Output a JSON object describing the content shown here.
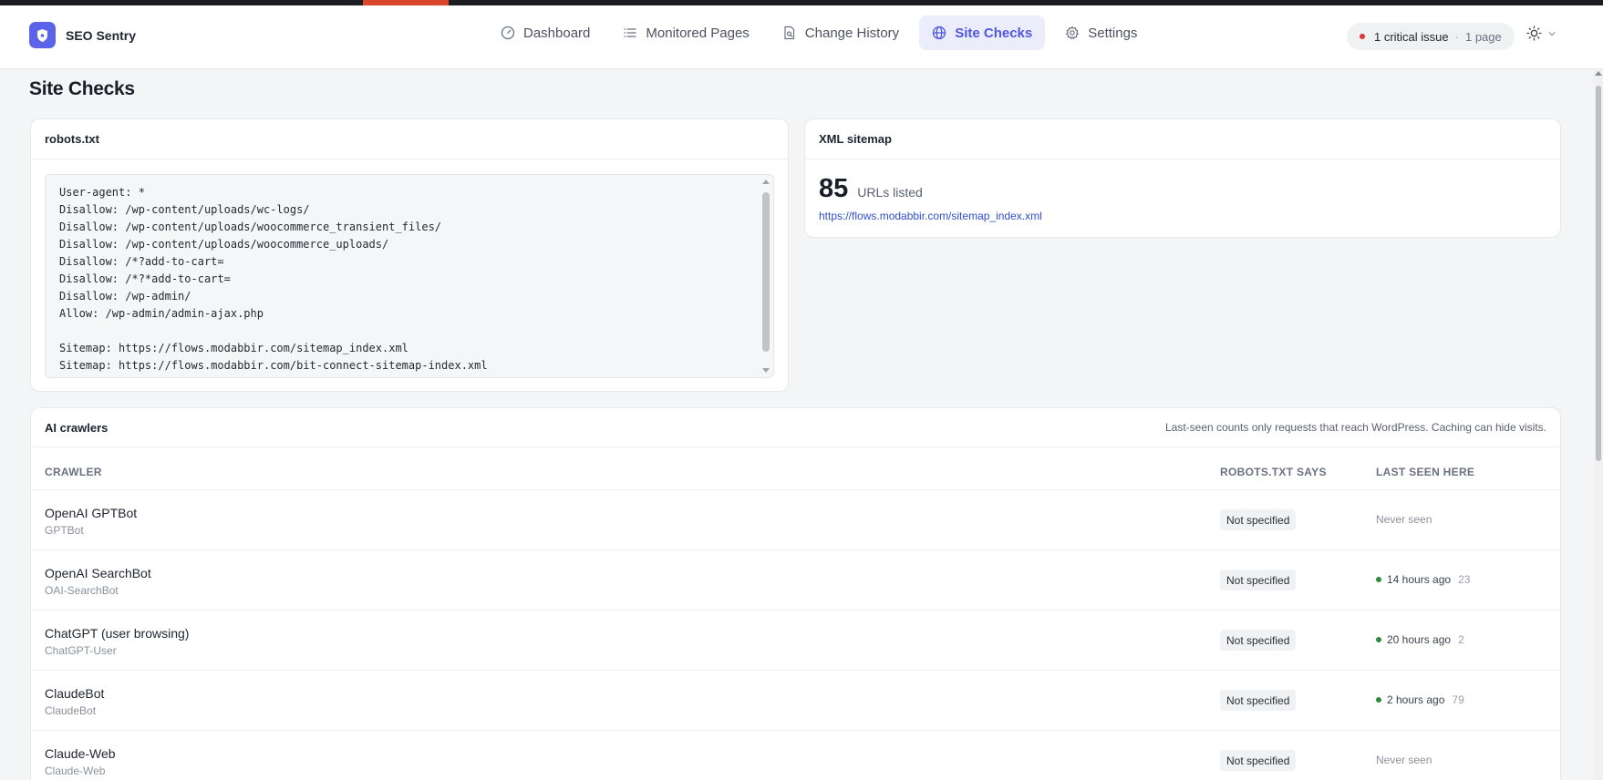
{
  "brand": {
    "name": "SEO Sentry"
  },
  "nav": [
    {
      "label": "Dashboard",
      "icon": "dashboard-gauge-icon",
      "active": false
    },
    {
      "label": "Monitored Pages",
      "icon": "list-icon",
      "active": false
    },
    {
      "label": "Change History",
      "icon": "document-search-icon",
      "active": false
    },
    {
      "label": "Site Checks",
      "icon": "globe-icon",
      "active": true
    },
    {
      "label": "Settings",
      "icon": "gear-icon",
      "active": false
    }
  ],
  "status": {
    "main": "1 critical issue",
    "separator": "·",
    "sub": "1 page"
  },
  "page": {
    "title": "Site Checks"
  },
  "robots": {
    "title": "robots.txt",
    "content": "User-agent: *\nDisallow: /wp-content/uploads/wc-logs/\nDisallow: /wp-content/uploads/woocommerce_transient_files/\nDisallow: /wp-content/uploads/woocommerce_uploads/\nDisallow: /*?add-to-cart=\nDisallow: /*?*add-to-cart=\nDisallow: /wp-admin/\nAllow: /wp-admin/admin-ajax.php\n\nSitemap: https://flows.modabbir.com/sitemap_index.xml\nSitemap: https://flows.modabbir.com/bit-connect-sitemap-index.xml"
  },
  "sitemap": {
    "title": "XML sitemap",
    "count": "85",
    "count_label": "URLs listed",
    "url": "https://flows.modabbir.com/sitemap_index.xml"
  },
  "crawlers": {
    "title": "AI crawlers",
    "note": "Last-seen counts only requests that reach WordPress. Caching can hide visits.",
    "columns": {
      "crawler": "CRAWLER",
      "robots": "ROBOTS.TXT SAYS",
      "last_seen": "LAST SEEN HERE"
    },
    "rows": [
      {
        "name": "OpenAI GPTBot",
        "agent": "GPTBot",
        "robots": "Not specified",
        "seen": "Never seen",
        "count": ""
      },
      {
        "name": "OpenAI SearchBot",
        "agent": "OAI-SearchBot",
        "robots": "Not specified",
        "seen": "14 hours ago",
        "count": "23"
      },
      {
        "name": "ChatGPT (user browsing)",
        "agent": "ChatGPT-User",
        "robots": "Not specified",
        "seen": "20 hours ago",
        "count": "2"
      },
      {
        "name": "ClaudeBot",
        "agent": "ClaudeBot",
        "robots": "Not specified",
        "seen": "2 hours ago",
        "count": "79"
      },
      {
        "name": "Claude-Web",
        "agent": "Claude-Web",
        "robots": "Not specified",
        "seen": "Never seen",
        "count": ""
      }
    ]
  },
  "colors": {
    "accent": "#4f57e0",
    "brand_logo": "#5b63e8",
    "critical": "#d93636",
    "seen": "#2e8b3e",
    "top_strip_accent": "#d9462b"
  }
}
